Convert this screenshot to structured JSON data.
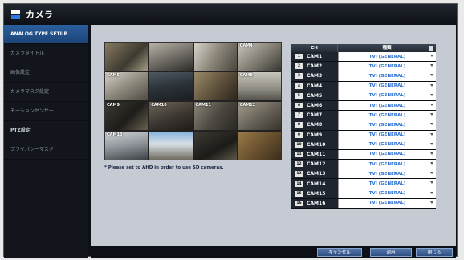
{
  "window": {
    "title": "カメラ",
    "icon": "camera-icon"
  },
  "sidebar": {
    "items": [
      {
        "label": "ANALOG TYPE SETUP"
      },
      {
        "label": "カメラタイトル"
      },
      {
        "label": "画像設定"
      },
      {
        "label": "カメラマスク設定"
      },
      {
        "label": "モーションセンサー"
      },
      {
        "label": "PTZ設定"
      },
      {
        "label": "プライバシーマスク"
      }
    ]
  },
  "preview": {
    "labels": [
      "",
      "",
      "",
      "CAM4",
      "CAM5",
      "",
      "",
      "CAM8",
      "CAM9",
      "CAM10",
      "CAM11",
      "CAM12",
      "CAM13",
      "",
      "",
      ""
    ],
    "note": "* Please set to AHD in order to use SD cameras."
  },
  "table": {
    "header_ch": "CH",
    "header_type": "種類",
    "rows": [
      {
        "num": "1",
        "cam": "CAM1",
        "type": "TVI (GENERAL)"
      },
      {
        "num": "2",
        "cam": "CAM2",
        "type": "TVI (GENERAL)"
      },
      {
        "num": "3",
        "cam": "CAM3",
        "type": "TVI (GENERAL)"
      },
      {
        "num": "4",
        "cam": "CAM4",
        "type": "TVI (GENERAL)"
      },
      {
        "num": "5",
        "cam": "CAM5",
        "type": "TVI (GENERAL)"
      },
      {
        "num": "6",
        "cam": "CAM6",
        "type": "TVI (GENERAL)"
      },
      {
        "num": "7",
        "cam": "CAM7",
        "type": "TVI (GENERAL)"
      },
      {
        "num": "8",
        "cam": "CAM8",
        "type": "TVI (GENERAL)"
      },
      {
        "num": "9",
        "cam": "CAM9",
        "type": "TVI (GENERAL)"
      },
      {
        "num": "10",
        "cam": "CAM10",
        "type": "TVI (GENERAL)"
      },
      {
        "num": "11",
        "cam": "CAM11",
        "type": "TVI (GENERAL)"
      },
      {
        "num": "12",
        "cam": "CAM12",
        "type": "TVI (GENERAL)"
      },
      {
        "num": "13",
        "cam": "CAM13",
        "type": "TVI (GENERAL)"
      },
      {
        "num": "14",
        "cam": "CAM14",
        "type": "TVI (GENERAL)"
      },
      {
        "num": "15",
        "cam": "CAM15",
        "type": "TVI (GENERAL)"
      },
      {
        "num": "16",
        "cam": "CAM16",
        "type": "TVI (GENERAL)"
      }
    ]
  },
  "footer": {
    "cancel": "キャンセル",
    "apply": "適用",
    "close": "閉じる"
  },
  "colors": {
    "accent": "#2b5f9e",
    "type_text": "#2a6fd0",
    "panel": "#c6cad2"
  }
}
